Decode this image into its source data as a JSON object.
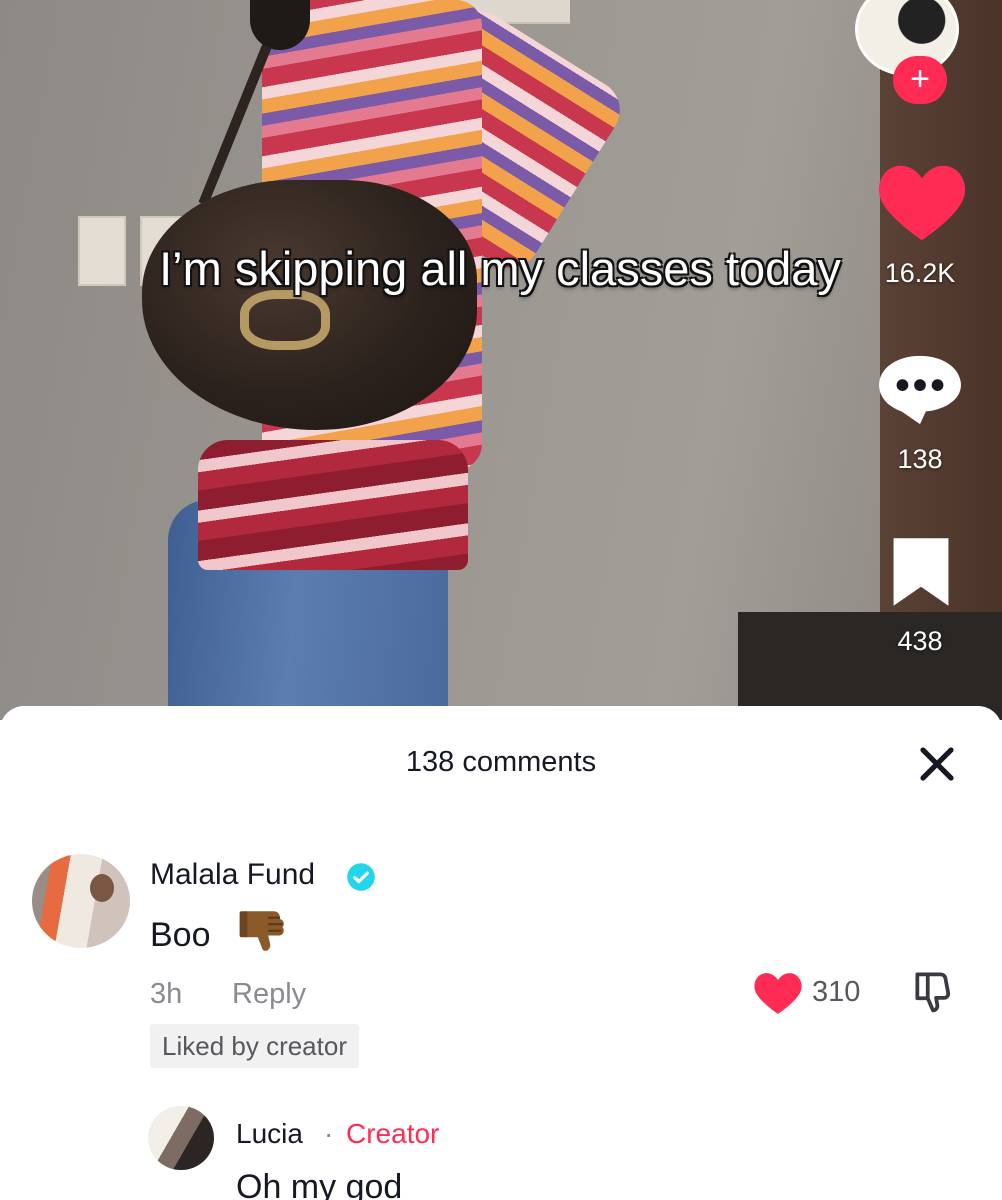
{
  "video": {
    "caption": "I’m skipping all my classes today"
  },
  "rail": {
    "follow_symbol": "+",
    "likes": "16.2K",
    "comments": "138",
    "saves": "438",
    "icons": [
      "creator-avatar",
      "follow-plus-icon",
      "heart-icon",
      "comment-bubble-icon",
      "bookmark-icon"
    ]
  },
  "sheet": {
    "title": "138 comments",
    "close_icon": "close-x-icon"
  },
  "comments": [
    {
      "author": "Malala Fund",
      "verified": true,
      "text": "Boo",
      "emoji": "thumbs-down",
      "time": "3h",
      "reply_label": "Reply",
      "badge": "Liked by creator",
      "likes": "310"
    }
  ],
  "reply": {
    "author": "Lucia",
    "separator": "·",
    "role": "Creator",
    "text": "Oh my god"
  },
  "colors": {
    "accent": "#fe2c55",
    "verified": "#20d5ec",
    "secondary_text": "#8a8b91",
    "primary_text": "#161823"
  }
}
